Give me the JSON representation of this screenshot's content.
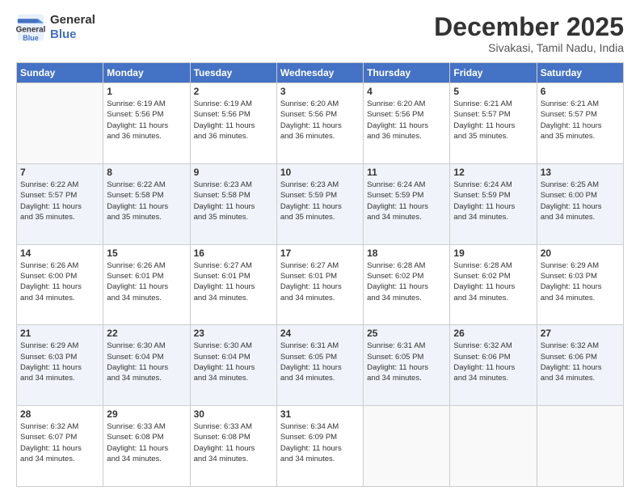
{
  "logo": {
    "line1": "General",
    "line2": "Blue"
  },
  "title": "December 2025",
  "location": "Sivakasi, Tamil Nadu, India",
  "days_header": [
    "Sunday",
    "Monday",
    "Tuesday",
    "Wednesday",
    "Thursday",
    "Friday",
    "Saturday"
  ],
  "weeks": [
    [
      {
        "day": "",
        "sunrise": "",
        "sunset": "",
        "daylight": ""
      },
      {
        "day": "1",
        "sunrise": "Sunrise: 6:19 AM",
        "sunset": "Sunset: 5:56 PM",
        "daylight": "Daylight: 11 hours and 36 minutes."
      },
      {
        "day": "2",
        "sunrise": "Sunrise: 6:19 AM",
        "sunset": "Sunset: 5:56 PM",
        "daylight": "Daylight: 11 hours and 36 minutes."
      },
      {
        "day": "3",
        "sunrise": "Sunrise: 6:20 AM",
        "sunset": "Sunset: 5:56 PM",
        "daylight": "Daylight: 11 hours and 36 minutes."
      },
      {
        "day": "4",
        "sunrise": "Sunrise: 6:20 AM",
        "sunset": "Sunset: 5:56 PM",
        "daylight": "Daylight: 11 hours and 36 minutes."
      },
      {
        "day": "5",
        "sunrise": "Sunrise: 6:21 AM",
        "sunset": "Sunset: 5:57 PM",
        "daylight": "Daylight: 11 hours and 35 minutes."
      },
      {
        "day": "6",
        "sunrise": "Sunrise: 6:21 AM",
        "sunset": "Sunset: 5:57 PM",
        "daylight": "Daylight: 11 hours and 35 minutes."
      }
    ],
    [
      {
        "day": "7",
        "sunrise": "Sunrise: 6:22 AM",
        "sunset": "Sunset: 5:57 PM",
        "daylight": "Daylight: 11 hours and 35 minutes."
      },
      {
        "day": "8",
        "sunrise": "Sunrise: 6:22 AM",
        "sunset": "Sunset: 5:58 PM",
        "daylight": "Daylight: 11 hours and 35 minutes."
      },
      {
        "day": "9",
        "sunrise": "Sunrise: 6:23 AM",
        "sunset": "Sunset: 5:58 PM",
        "daylight": "Daylight: 11 hours and 35 minutes."
      },
      {
        "day": "10",
        "sunrise": "Sunrise: 6:23 AM",
        "sunset": "Sunset: 5:59 PM",
        "daylight": "Daylight: 11 hours and 35 minutes."
      },
      {
        "day": "11",
        "sunrise": "Sunrise: 6:24 AM",
        "sunset": "Sunset: 5:59 PM",
        "daylight": "Daylight: 11 hours and 34 minutes."
      },
      {
        "day": "12",
        "sunrise": "Sunrise: 6:24 AM",
        "sunset": "Sunset: 5:59 PM",
        "daylight": "Daylight: 11 hours and 34 minutes."
      },
      {
        "day": "13",
        "sunrise": "Sunrise: 6:25 AM",
        "sunset": "Sunset: 6:00 PM",
        "daylight": "Daylight: 11 hours and 34 minutes."
      }
    ],
    [
      {
        "day": "14",
        "sunrise": "Sunrise: 6:26 AM",
        "sunset": "Sunset: 6:00 PM",
        "daylight": "Daylight: 11 hours and 34 minutes."
      },
      {
        "day": "15",
        "sunrise": "Sunrise: 6:26 AM",
        "sunset": "Sunset: 6:01 PM",
        "daylight": "Daylight: 11 hours and 34 minutes."
      },
      {
        "day": "16",
        "sunrise": "Sunrise: 6:27 AM",
        "sunset": "Sunset: 6:01 PM",
        "daylight": "Daylight: 11 hours and 34 minutes."
      },
      {
        "day": "17",
        "sunrise": "Sunrise: 6:27 AM",
        "sunset": "Sunset: 6:01 PM",
        "daylight": "Daylight: 11 hours and 34 minutes."
      },
      {
        "day": "18",
        "sunrise": "Sunrise: 6:28 AM",
        "sunset": "Sunset: 6:02 PM",
        "daylight": "Daylight: 11 hours and 34 minutes."
      },
      {
        "day": "19",
        "sunrise": "Sunrise: 6:28 AM",
        "sunset": "Sunset: 6:02 PM",
        "daylight": "Daylight: 11 hours and 34 minutes."
      },
      {
        "day": "20",
        "sunrise": "Sunrise: 6:29 AM",
        "sunset": "Sunset: 6:03 PM",
        "daylight": "Daylight: 11 hours and 34 minutes."
      }
    ],
    [
      {
        "day": "21",
        "sunrise": "Sunrise: 6:29 AM",
        "sunset": "Sunset: 6:03 PM",
        "daylight": "Daylight: 11 hours and 34 minutes."
      },
      {
        "day": "22",
        "sunrise": "Sunrise: 6:30 AM",
        "sunset": "Sunset: 6:04 PM",
        "daylight": "Daylight: 11 hours and 34 minutes."
      },
      {
        "day": "23",
        "sunrise": "Sunrise: 6:30 AM",
        "sunset": "Sunset: 6:04 PM",
        "daylight": "Daylight: 11 hours and 34 minutes."
      },
      {
        "day": "24",
        "sunrise": "Sunrise: 6:31 AM",
        "sunset": "Sunset: 6:05 PM",
        "daylight": "Daylight: 11 hours and 34 minutes."
      },
      {
        "day": "25",
        "sunrise": "Sunrise: 6:31 AM",
        "sunset": "Sunset: 6:05 PM",
        "daylight": "Daylight: 11 hours and 34 minutes."
      },
      {
        "day": "26",
        "sunrise": "Sunrise: 6:32 AM",
        "sunset": "Sunset: 6:06 PM",
        "daylight": "Daylight: 11 hours and 34 minutes."
      },
      {
        "day": "27",
        "sunrise": "Sunrise: 6:32 AM",
        "sunset": "Sunset: 6:06 PM",
        "daylight": "Daylight: 11 hours and 34 minutes."
      }
    ],
    [
      {
        "day": "28",
        "sunrise": "Sunrise: 6:32 AM",
        "sunset": "Sunset: 6:07 PM",
        "daylight": "Daylight: 11 hours and 34 minutes."
      },
      {
        "day": "29",
        "sunrise": "Sunrise: 6:33 AM",
        "sunset": "Sunset: 6:08 PM",
        "daylight": "Daylight: 11 hours and 34 minutes."
      },
      {
        "day": "30",
        "sunrise": "Sunrise: 6:33 AM",
        "sunset": "Sunset: 6:08 PM",
        "daylight": "Daylight: 11 hours and 34 minutes."
      },
      {
        "day": "31",
        "sunrise": "Sunrise: 6:34 AM",
        "sunset": "Sunset: 6:09 PM",
        "daylight": "Daylight: 11 hours and 34 minutes."
      },
      {
        "day": "",
        "sunrise": "",
        "sunset": "",
        "daylight": ""
      },
      {
        "day": "",
        "sunrise": "",
        "sunset": "",
        "daylight": ""
      },
      {
        "day": "",
        "sunrise": "",
        "sunset": "",
        "daylight": ""
      }
    ]
  ]
}
